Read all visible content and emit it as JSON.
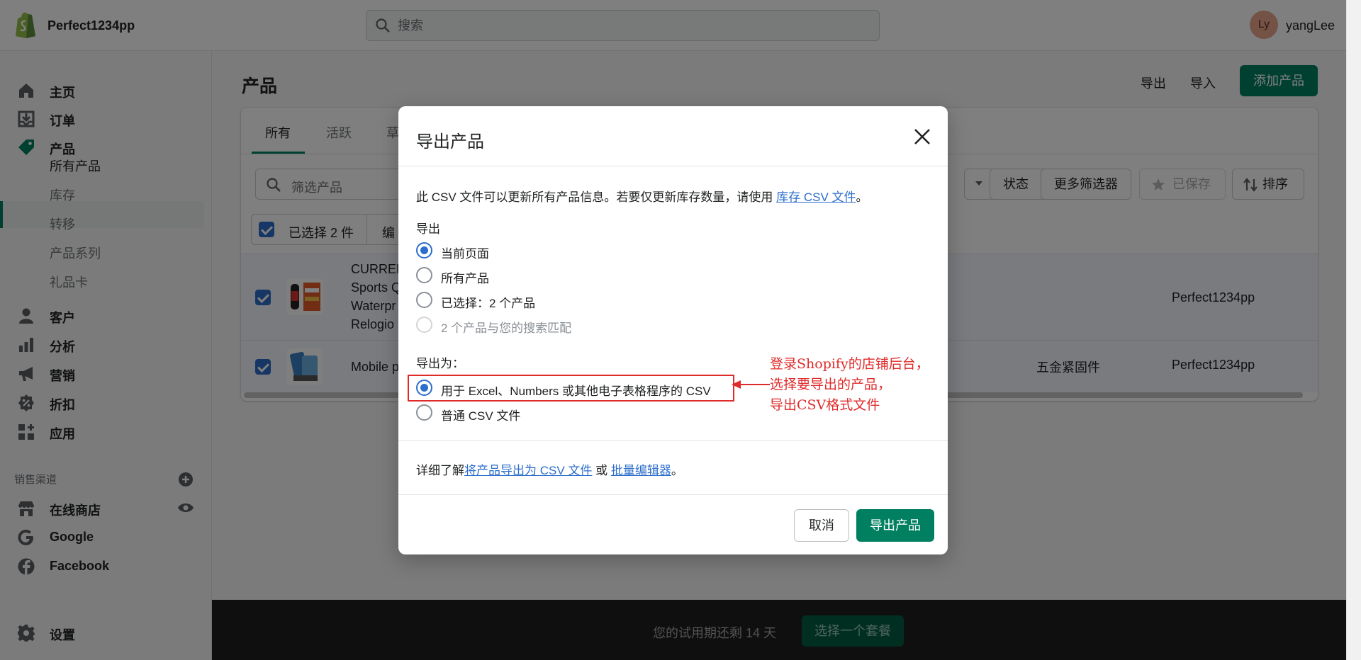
{
  "topbar": {
    "store_name": "Perfect1234pp",
    "search_placeholder": "搜索",
    "avatar_initials": "Ly",
    "username": "yangLee"
  },
  "sidebar": {
    "items": [
      {
        "label": "主页",
        "icon": "home-icon"
      },
      {
        "label": "订单",
        "icon": "orders-icon"
      },
      {
        "label": "产品",
        "icon": "tag-icon"
      },
      {
        "label": "客户",
        "icon": "person-icon"
      },
      {
        "label": "分析",
        "icon": "bar-chart-icon"
      },
      {
        "label": "营销",
        "icon": "megaphone-icon"
      },
      {
        "label": "折扣",
        "icon": "discount-icon"
      },
      {
        "label": "应用",
        "icon": "apps-icon"
      }
    ],
    "product_subitems": [
      "所有产品",
      "库存",
      "转移",
      "产品系列",
      "礼品卡"
    ],
    "sales_channels_label": "销售渠道",
    "channels": [
      {
        "label": "在线商店",
        "icon": "store-icon"
      },
      {
        "label": "Google",
        "icon": "google-icon"
      },
      {
        "label": "Facebook",
        "icon": "facebook-icon"
      }
    ],
    "settings_label": "设置"
  },
  "page": {
    "title": "产品",
    "export_label": "导出",
    "import_label": "导入",
    "add_product_label": "添加产品"
  },
  "tabs": [
    "所有",
    "活跃",
    "草"
  ],
  "filters": {
    "filter_placeholder": "筛选产品",
    "status_label": "状态",
    "more_filters_label": "更多筛选器",
    "saved_label": "已保存",
    "sort_label": "排序"
  },
  "bulk": {
    "selected_label": "已选择 2 件",
    "edit_label": "编"
  },
  "products": [
    {
      "name_lines": [
        "CURREN",
        "Sports Q",
        "Waterpr",
        "Relogio"
      ],
      "type": "",
      "vendor": "Perfect1234pp"
    },
    {
      "name_lines": [
        "Mobile p"
      ],
      "type": "五金紧固件",
      "vendor": "Perfect1234pp"
    }
  ],
  "trial": {
    "message": "您的试用期还剩 14 天",
    "button_label": "选择一个套餐"
  },
  "modal": {
    "title": "导出产品",
    "intro_text": "此 CSV 文件可以更新所有产品信息。若要仅更新库存数量，请使用 ",
    "intro_link": "库存 CSV 文件",
    "intro_end": "。",
    "export_heading": "导出",
    "export_options": [
      {
        "label": "当前页面",
        "selected": true,
        "disabled": false
      },
      {
        "label": "所有产品",
        "selected": false,
        "disabled": false
      },
      {
        "label": "已选择：2 个产品",
        "selected": false,
        "disabled": false
      },
      {
        "label": "2 个产品与您的搜索匹配",
        "selected": false,
        "disabled": true
      }
    ],
    "format_heading": "导出为：",
    "format_options": [
      {
        "label": "用于 Excel、Numbers 或其他电子表格程序的 CSV",
        "selected": true
      },
      {
        "label": "普通 CSV 文件",
        "selected": false
      }
    ],
    "learn_prefix": "详细了解",
    "learn_link1": "将产品导出为 CSV 文件",
    "learn_or": " 或 ",
    "learn_link2": "批量编辑器",
    "learn_end": "。",
    "cancel_label": "取消",
    "export_label": "导出产品"
  },
  "annotation": {
    "lines": [
      "登录Shopify的店铺后台，",
      "选择要导出的产品，",
      "导出CSV格式文件"
    ],
    "color": "#e02b2b"
  },
  "colors": {
    "accent": "#008060",
    "link": "#2c6ecb"
  }
}
